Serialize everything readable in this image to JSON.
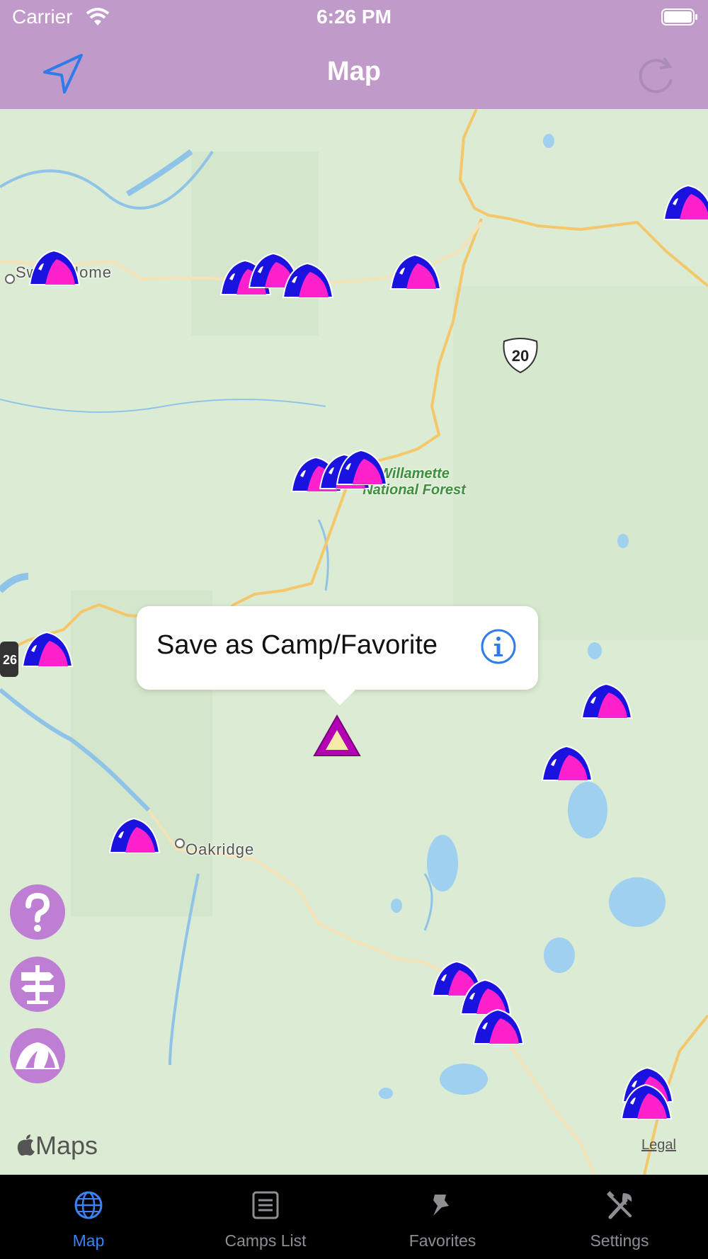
{
  "status_bar": {
    "carrier": "Carrier",
    "time": "6:26 PM"
  },
  "nav": {
    "title": "Map"
  },
  "map": {
    "place_labels": {
      "sweet_home": "Sweet Home",
      "oakridge": "Oakridge"
    },
    "forest_label_line1": "Willamette",
    "forest_label_line2": "National Forest",
    "route_20": "20",
    "route_26": "26",
    "attribution": "Maps",
    "legal": "Legal"
  },
  "callout": {
    "text": "Save as Camp/Favorite"
  },
  "tabs": [
    {
      "label": "Map",
      "icon": "globe-icon",
      "active": true
    },
    {
      "label": "Camps List",
      "icon": "list-icon",
      "active": false
    },
    {
      "label": "Favorites",
      "icon": "pin-icon",
      "active": false
    },
    {
      "label": "Settings",
      "icon": "tools-icon",
      "active": false
    }
  ],
  "colors": {
    "header": "#c09bc9",
    "accent": "#3a82f6",
    "tent_blue": "#1a13e0",
    "tent_pink": "#ff22cc",
    "button_purple": "#bd7ed3"
  }
}
